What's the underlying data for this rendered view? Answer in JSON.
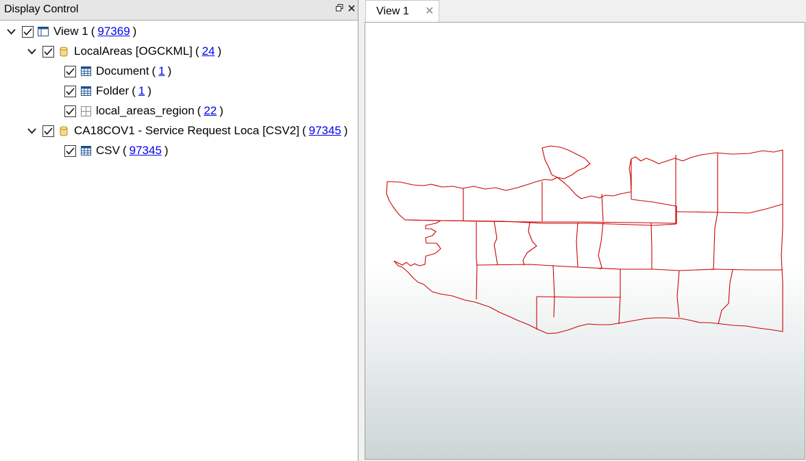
{
  "display_control": {
    "title": "Display Control",
    "float_icon": "restore-icon",
    "close_icon": "close-icon",
    "tree": [
      {
        "label": "View 1",
        "count": "97369",
        "expanded": true,
        "checked": true,
        "icon": "view-window-icon"
      },
      {
        "label": "LocalAreas [OGCKML]",
        "count": "24",
        "expanded": true,
        "checked": true,
        "icon": "database-icon"
      },
      {
        "label": "Document",
        "count": "1",
        "checked": true,
        "icon": "table-grid-icon"
      },
      {
        "label": "Folder",
        "count": "1",
        "checked": true,
        "icon": "table-grid-icon"
      },
      {
        "label": "local_areas_region",
        "count": "22",
        "checked": true,
        "icon": "region-grid-icon"
      },
      {
        "label": "CA18COV1 - Service Request Loca [CSV2]",
        "count": "97345",
        "expanded": true,
        "checked": true,
        "icon": "database-icon"
      },
      {
        "label": "CSV",
        "count": "97345",
        "checked": true,
        "icon": "table-grid-icon"
      }
    ],
    "paren_open": "(",
    "paren_close": ")"
  },
  "tabs": [
    {
      "label": "View 1",
      "close": "✕",
      "active": true
    }
  ],
  "map": {
    "stroke_color": "#cc0000",
    "background_top": "#ffffff",
    "background_bottom": "#ccd5d5"
  }
}
